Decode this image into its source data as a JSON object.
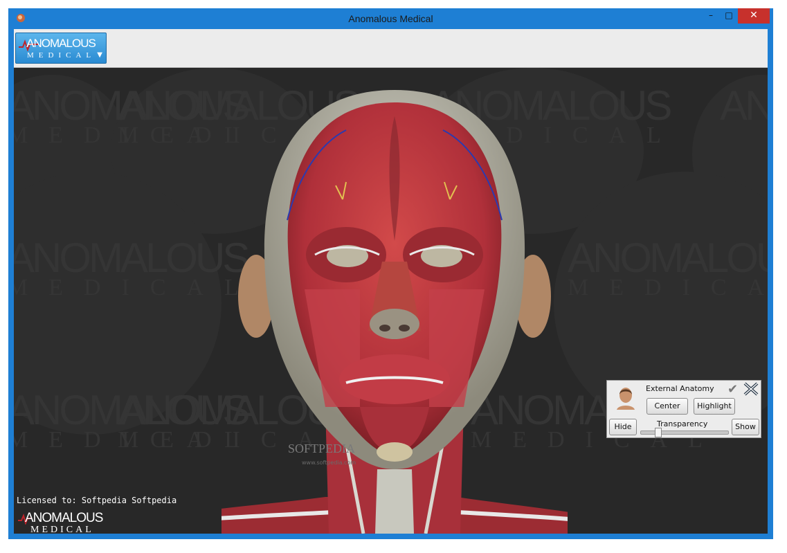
{
  "window": {
    "title": "Anomalous Medical",
    "controls": {
      "minimize": "–",
      "maximize": "□",
      "close": "✕"
    }
  },
  "toolbar": {
    "logo_top": "ANOMALOUS",
    "logo_bottom": "MEDICAL",
    "caret": "▼"
  },
  "viewport": {
    "watermark_top": "ANOMALOUS",
    "watermark_bottom": "MEDICAL",
    "license_text": "Licensed to: Softpedia Softpedia",
    "corner_logo_top": "ANOMALOUS",
    "corner_logo_bottom": "MEDICAL",
    "softpedia": "SOFTPEDIA",
    "softpedia_url": "www.softpedia.com"
  },
  "panel": {
    "title": "External Anatomy",
    "center_label": "Center",
    "highlight_label": "Highlight",
    "hide_label": "Hide",
    "show_label": "Show",
    "transparency_label": "Transparency",
    "transparency_value": 0.18,
    "check_glyph": "✔"
  },
  "colors": {
    "frame": "#1e7fd4",
    "viewport_bg": "#282828",
    "muscle": "#b8383a",
    "close_button": "#c7312c"
  }
}
